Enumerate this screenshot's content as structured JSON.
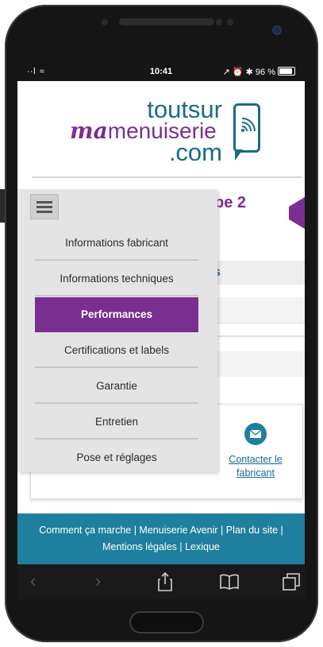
{
  "status_bar": {
    "left": "∙∙l ≈",
    "time": "10:41",
    "right": "↗ ⏰ ✱ 96 %"
  },
  "logo": {
    "line1": "toutsur",
    "line2_ma": "ma",
    "line2_rest": "menuiserie",
    "line3": ".com",
    "icon": "phone-chat-icon"
  },
  "page": {
    "heading_fragment": "pe 2",
    "row_fragment": "s"
  },
  "menu": {
    "toggle_icon": "hamburger-icon",
    "items": [
      {
        "label": "Informations fabricant",
        "active": false
      },
      {
        "label": "Informations techniques",
        "active": false
      },
      {
        "label": "Performances",
        "active": true
      },
      {
        "label": "Certifications et labels",
        "active": false
      },
      {
        "label": "Garantie",
        "active": false
      },
      {
        "label": "Entretien",
        "active": false
      },
      {
        "label": "Pose et réglages",
        "active": false
      }
    ]
  },
  "contact": {
    "icon": "mail-icon",
    "label_line1": "Contacter le",
    "label_line2": "fabricant"
  },
  "footer": {
    "line1": "Comment ça marche | Menuiserie Avenir | Plan du site |",
    "line2": "Mentions légales | Lexique"
  },
  "browser_toolbar": {
    "back": "‹",
    "forward": "›",
    "share_icon": "share-icon",
    "bookmarks_icon": "book-icon",
    "tabs_icon": "tabs-icon"
  },
  "colors": {
    "brand_purple": "#7a2f90",
    "brand_teal": "#1f7f9e"
  }
}
